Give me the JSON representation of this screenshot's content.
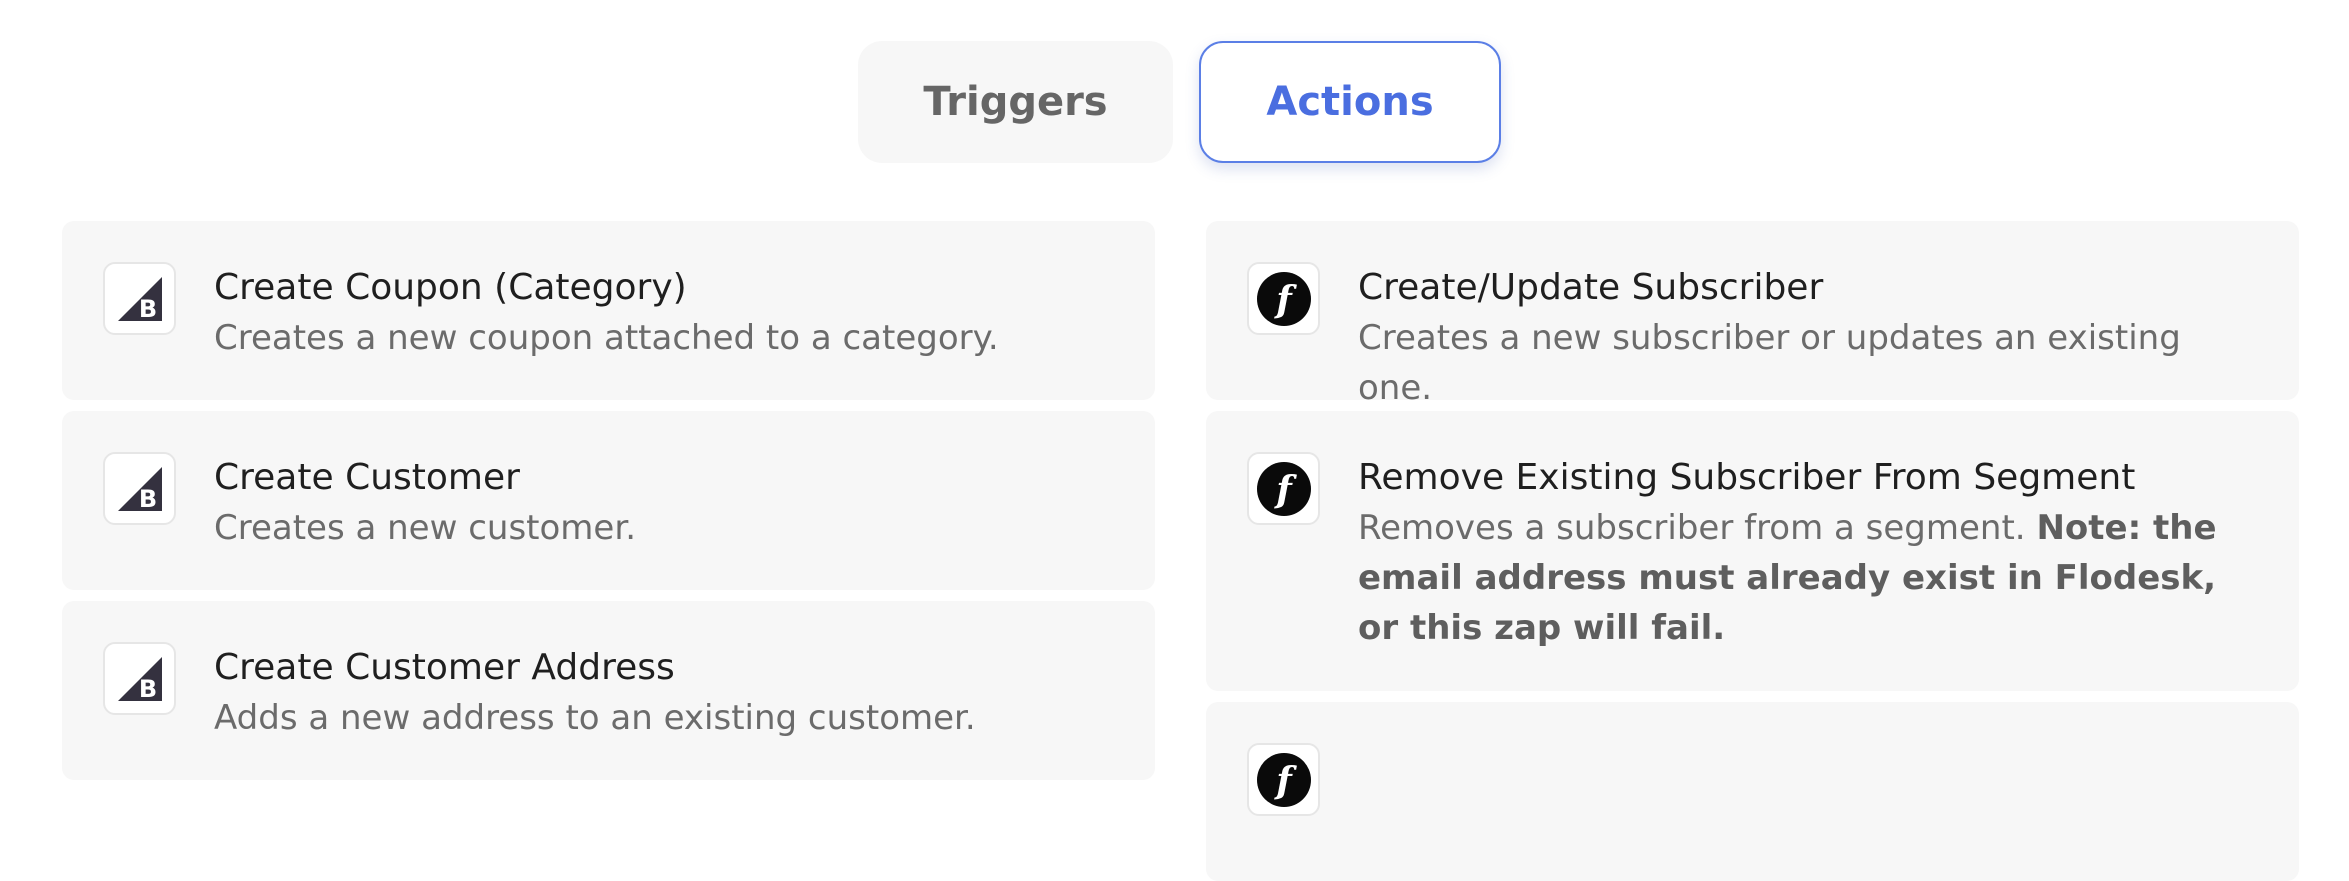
{
  "tabs": {
    "triggers_label": "Triggers",
    "actions_label": "Actions"
  },
  "colors": {
    "accent": "#4a6ee0",
    "card_bg": "#f7f7f7",
    "title_text": "#1f1f1f",
    "desc_text": "#6b6b6b"
  },
  "left_column": [
    {
      "icon": "bigcommerce-icon",
      "title": "Create Coupon (Category)",
      "description": "Creates a new coupon attached to a category."
    },
    {
      "icon": "bigcommerce-icon",
      "title": "Create Customer",
      "description": "Creates a new customer."
    },
    {
      "icon": "bigcommerce-icon",
      "title": "Create Customer Address",
      "description": "Adds a new address to an existing customer."
    }
  ],
  "right_column": [
    {
      "icon": "flodesk-icon",
      "title": "Create/Update Subscriber",
      "description": "Creates a new subscriber or updates an existing one."
    },
    {
      "icon": "flodesk-icon",
      "title": "Remove Existing Subscriber From Segment",
      "description": "Removes a subscriber from a segment.",
      "note": "Note: the email address must already exist in Flodesk, or this zap will fail."
    },
    {
      "icon": "flodesk-icon"
    }
  ]
}
